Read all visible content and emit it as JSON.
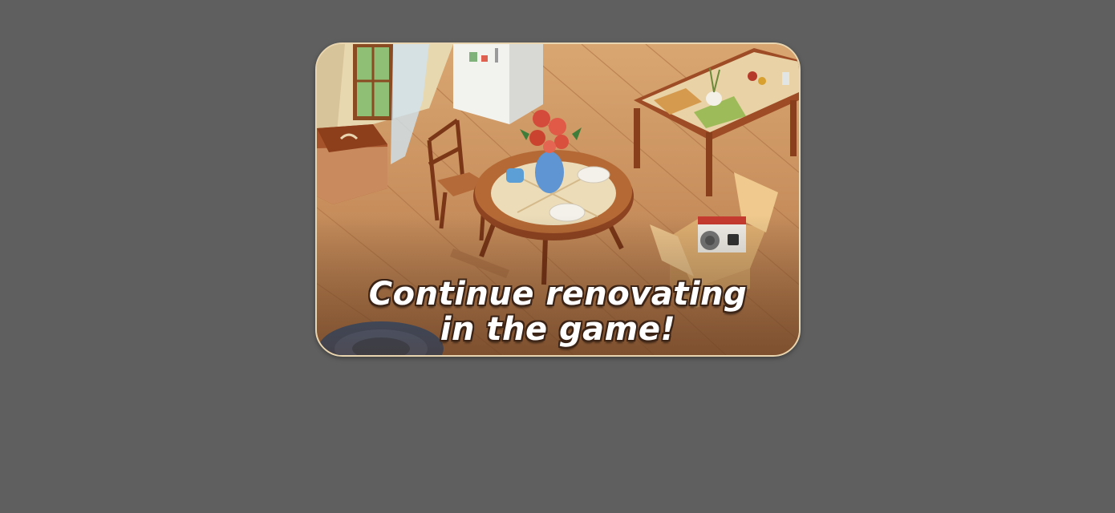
{
  "promo": {
    "line1": "Continue renovating",
    "line2": "in the game!"
  },
  "colors": {
    "background": "#5f5f5f",
    "card_border": "#e9d6b0",
    "floor": "#c98f5a",
    "caption_text": "#ffffff",
    "caption_outline": "#3b2316"
  }
}
